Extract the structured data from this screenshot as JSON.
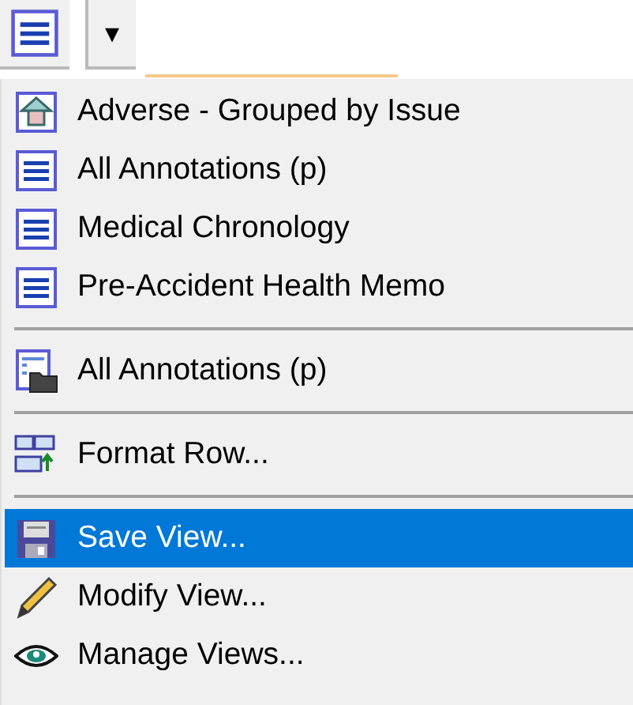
{
  "toolbar": {
    "view_button": {
      "kind": "report-view"
    },
    "dropdown_button": {
      "label": "▾"
    }
  },
  "menu": [
    {
      "kind": "grouped-view",
      "label": "Adverse - Grouped by Issue",
      "selected": false
    },
    {
      "kind": "report-view",
      "label": "All Annotations (p)",
      "selected": false
    },
    {
      "kind": "report-view",
      "label": "Medical Chronology",
      "selected": false
    },
    {
      "kind": "report-view",
      "label": "Pre-Accident Health Memo",
      "selected": false
    },
    {
      "kind": "separator"
    },
    {
      "kind": "folder-view",
      "label": "All Annotations (p)",
      "selected": false
    },
    {
      "kind": "separator"
    },
    {
      "kind": "format",
      "label": "Format Row...",
      "selected": false
    },
    {
      "kind": "separator"
    },
    {
      "kind": "save",
      "label": "Save View...",
      "selected": true
    },
    {
      "kind": "edit",
      "label": "Modify View...",
      "selected": false
    },
    {
      "kind": "manage",
      "label": "Manage Views...",
      "selected": false
    }
  ]
}
